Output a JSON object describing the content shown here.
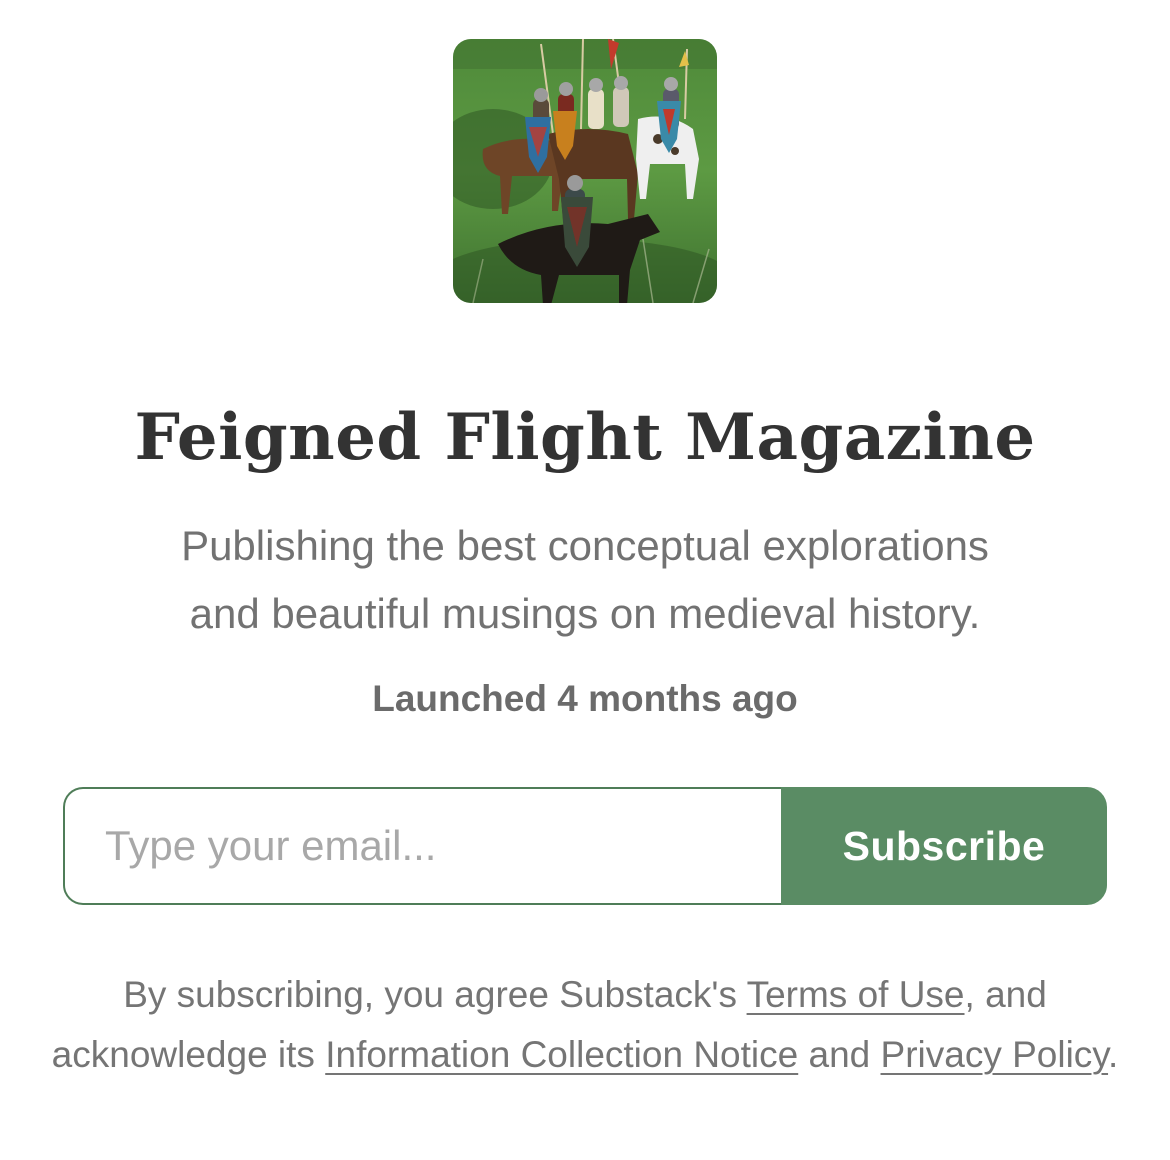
{
  "publication": {
    "name": "Feigned Flight Magazine",
    "description_line1": "Publishing the best conceptual explorations",
    "description_line2": "and beautiful musings on medieval history.",
    "launched": "Launched 4 months ago"
  },
  "subscribe_form": {
    "email_placeholder": "Type your email...",
    "email_value": "",
    "button_label": "Subscribe"
  },
  "legal": {
    "text_1": "By subscribing, you agree Substack's ",
    "terms_link": "Terms of Use",
    "text_2": ", and acknowledge its ",
    "info_link": "Information Collection Notice",
    "text_3": " and ",
    "privacy_link": "Privacy Policy",
    "text_4": "."
  },
  "colors": {
    "accent": "#5a8c64",
    "title": "#333333",
    "muted": "#757575"
  },
  "icons": {
    "logo": "medieval-knights-on-horseback-image"
  }
}
